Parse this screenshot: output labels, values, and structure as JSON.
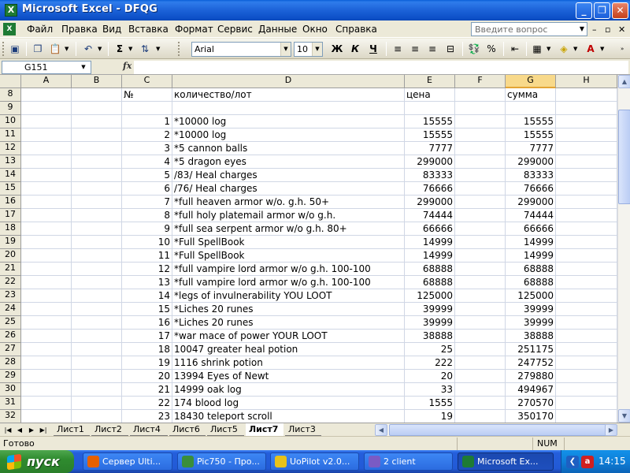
{
  "window": {
    "title": "Microsoft Excel - DFQG",
    "minimize_label": "_",
    "restore_label": "❐",
    "close_label": "✕"
  },
  "menu": {
    "items": [
      "Файл",
      "Правка",
      "Вид",
      "Вставка",
      "Формат",
      "Сервис",
      "Данные",
      "Окно",
      "Справка"
    ],
    "help_placeholder": "Введите вопрос",
    "doc_controls": [
      "–",
      "▫",
      "✕"
    ]
  },
  "toolbar": {
    "font_name": "Arial",
    "font_size": "10",
    "bold_label": "Ж",
    "italic_label": "К",
    "underline_label": "Ч",
    "percent_label": "%"
  },
  "formula_bar": {
    "cell_ref": "G151",
    "fx_label": "fx",
    "value": ""
  },
  "columns": [
    "A",
    "B",
    "C",
    "D",
    "E",
    "F",
    "G",
    "H"
  ],
  "selected_column": "G",
  "rows": [
    {
      "row": "8",
      "C": "№",
      "D": "количество/лот",
      "E": "цена",
      "G": "сумма"
    },
    {
      "row": "9",
      "C": "",
      "D": "",
      "E": "",
      "G": ""
    },
    {
      "row": "10",
      "C": "1",
      "D": "*10000 log",
      "E": "15555",
      "G": "15555"
    },
    {
      "row": "11",
      "C": "2",
      "D": "*10000 log",
      "E": "15555",
      "G": "15555"
    },
    {
      "row": "12",
      "C": "3",
      "D": "*5 cannon balls",
      "E": "7777",
      "G": "7777"
    },
    {
      "row": "13",
      "C": "4",
      "D": "*5 dragon eyes",
      "E": "299000",
      "G": "299000"
    },
    {
      "row": "14",
      "C": "5",
      "D": "/83/ Heal charges",
      "E": "83333",
      "G": "83333"
    },
    {
      "row": "15",
      "C": "6",
      "D": "/76/ Heal charges",
      "E": "76666",
      "G": "76666"
    },
    {
      "row": "16",
      "C": "7",
      "D": "*full heaven armor w/o. g.h. 50+",
      "E": "299000",
      "G": "299000"
    },
    {
      "row": "17",
      "C": "8",
      "D": "*full holy platemail armor w/o g.h.",
      "E": "74444",
      "G": "74444"
    },
    {
      "row": "18",
      "C": "9",
      "D": "*full sea serpent armor w/o g.h. 80+",
      "E": "66666",
      "G": "66666"
    },
    {
      "row": "19",
      "C": "10",
      "D": "*Full SpellBook",
      "E": "14999",
      "G": "14999"
    },
    {
      "row": "20",
      "C": "11",
      "D": "*Full SpellBook",
      "E": "14999",
      "G": "14999"
    },
    {
      "row": "21",
      "C": "12",
      "D": "*full vampire lord armor w/o g.h. 100-100",
      "E": "68888",
      "G": "68888"
    },
    {
      "row": "22",
      "C": "13",
      "D": "*full vampire lord armor w/o g.h. 100-100",
      "E": "68888",
      "G": "68888"
    },
    {
      "row": "23",
      "C": "14",
      "D": "*legs of invulnerability YOU LOOT",
      "E": "125000",
      "G": "125000"
    },
    {
      "row": "24",
      "C": "15",
      "D": "*Liches 20 runes",
      "E": "39999",
      "G": "39999"
    },
    {
      "row": "25",
      "C": "16",
      "D": "*Liches 20 runes",
      "E": "39999",
      "G": "39999"
    },
    {
      "row": "26",
      "C": "17",
      "D": "*war mace of power YOUR LOOT",
      "E": "38888",
      "G": "38888"
    },
    {
      "row": "27",
      "C": "18",
      "D": "10047 greater heal potion",
      "E": "25",
      "G": "251175"
    },
    {
      "row": "28",
      "C": "19",
      "D": "1116 shrink potion",
      "E": "222",
      "G": "247752"
    },
    {
      "row": "29",
      "C": "20",
      "D": "13994 Eyes of Newt",
      "E": "20",
      "G": "279880"
    },
    {
      "row": "30",
      "C": "21",
      "D": "14999 oak log",
      "E": "33",
      "G": "494967"
    },
    {
      "row": "31",
      "C": "22",
      "D": "174 blood log",
      "E": "1555",
      "G": "270570"
    },
    {
      "row": "32",
      "C": "23",
      "D": "18430 teleport scroll",
      "E": "19",
      "G": "350170"
    }
  ],
  "sheet_tabs": [
    "Лист1",
    "Лист2",
    "Лист4",
    "Лист6",
    "Лист5",
    "Лист7",
    "Лист3"
  ],
  "active_sheet": "Лист7",
  "status": {
    "ready": "Готово",
    "num": "NUM"
  },
  "taskbar": {
    "start_label": "пуск",
    "buttons": [
      {
        "label": "Сервер Ulti...",
        "icon": "firefox-icon",
        "color": "#E66000"
      },
      {
        "label": "Pic750 - Про...",
        "icon": "image-viewer-icon",
        "color": "#3A8E3A"
      },
      {
        "label": "UoPilot  v2.0...",
        "icon": "smiley-icon",
        "color": "#E8C21A"
      },
      {
        "label": "2 client",
        "icon": "game-client-icon",
        "color": "#7A5BC4"
      },
      {
        "label": "Microsoft Ex...",
        "icon": "excel-icon",
        "color": "#1E7B34"
      }
    ],
    "active_button": "Microsoft Ex...",
    "clock": "14:15"
  },
  "colors": {
    "titlebar": "#0A5FD8",
    "selected_header": "#F8D98A",
    "grid_line": "#D0D7E5",
    "taskbar": "#245EDB",
    "start": "#2F8B2F"
  }
}
